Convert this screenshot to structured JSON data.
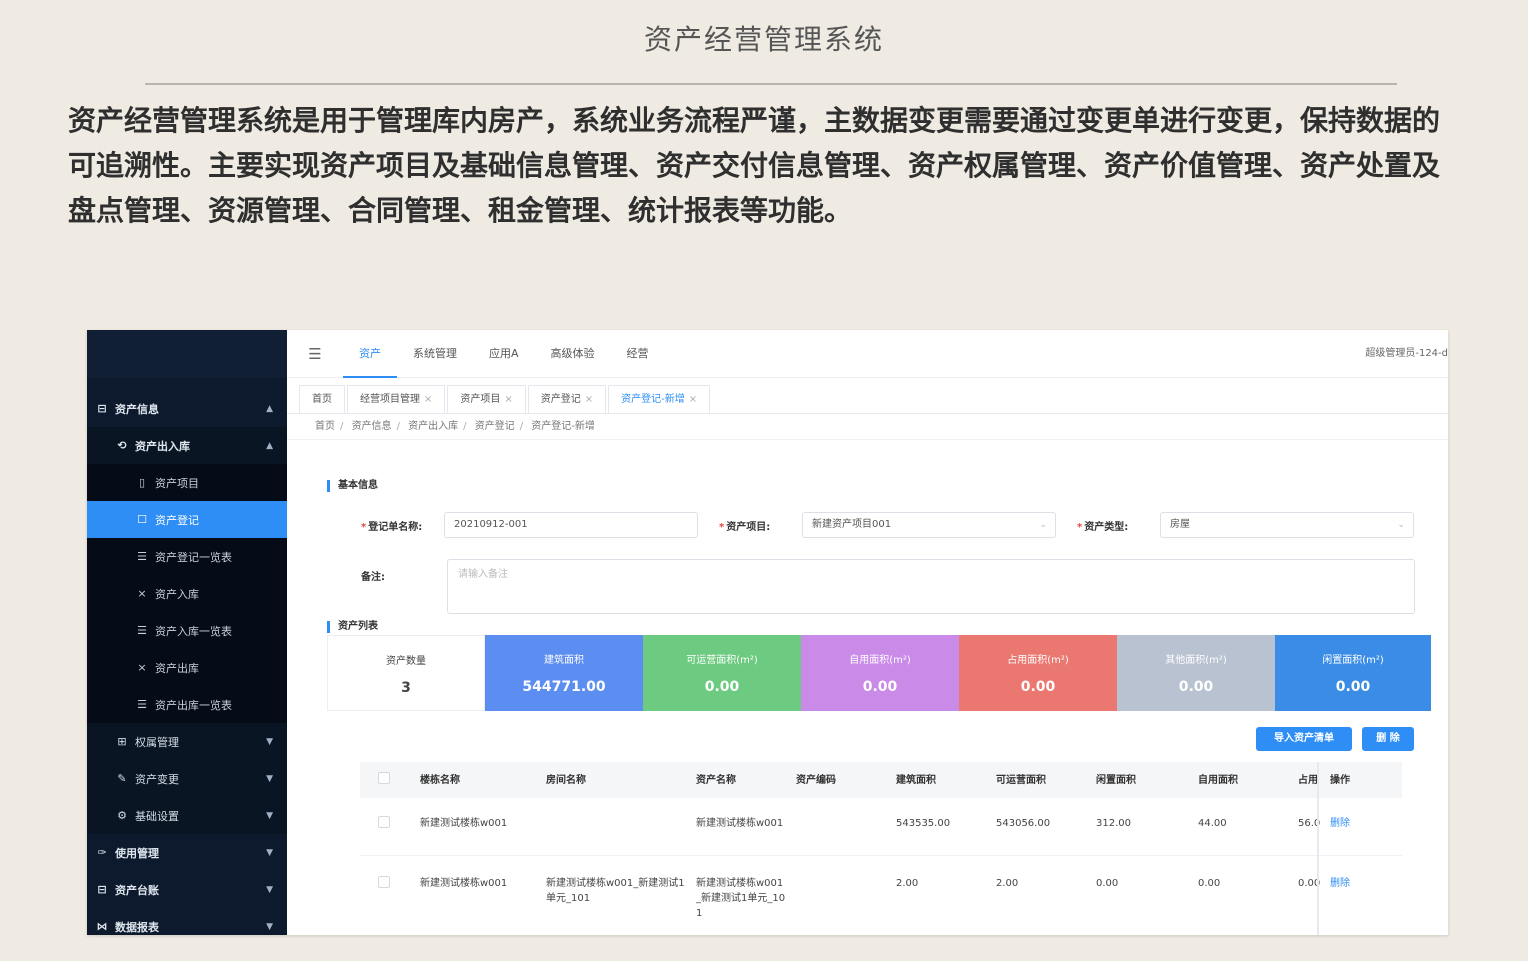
{
  "slide": {
    "title": "资产经营管理系统",
    "description": "资产经营管理系统是用于管理库内房产，系统业务流程严谨，主数据变更需要通过变更单进行变更，保持数据的可追溯性。主要实现资产项目及基础信息管理、资产交付信息管理、资产权属管理、资产价值管理、资产处置及盘点管理、资源管理、合同管理、租金管理、统计报表等功能。"
  },
  "sidebar": {
    "items": [
      {
        "label": "资产信息",
        "icon": "square-icon"
      },
      {
        "label": "资产出入库",
        "icon": "sync-icon"
      },
      {
        "label": "资产项目",
        "icon": "document-icon"
      },
      {
        "label": "资产登记",
        "icon": "form-icon"
      },
      {
        "label": "资产登记一览表",
        "icon": "list-icon"
      },
      {
        "label": "资产入库",
        "icon": "close-icon"
      },
      {
        "label": "资产入库一览表",
        "icon": "list-icon"
      },
      {
        "label": "资产出库",
        "icon": "close-icon"
      },
      {
        "label": "资产出库一览表",
        "icon": "list-icon"
      },
      {
        "label": "权属管理",
        "icon": "grid-icon"
      },
      {
        "label": "资产变更",
        "icon": "edit-icon"
      },
      {
        "label": "基础设置",
        "icon": "gear-icon"
      },
      {
        "label": "使用管理",
        "icon": "wrench-icon"
      },
      {
        "label": "资产台账",
        "icon": "square-icon"
      },
      {
        "label": "数据报表",
        "icon": "chart-icon"
      }
    ]
  },
  "topbar": {
    "tabs": [
      "资产",
      "系统管理",
      "应用A",
      "高级体验",
      "经营"
    ],
    "user": "超级管理员-124-d"
  },
  "page_tabs": [
    "首页",
    "经营项目管理",
    "资产项目",
    "资产登记",
    "资产登记-新增"
  ],
  "breadcrumb": [
    "首页",
    "资产信息",
    "资产出入库",
    "资产登记",
    "资产登记-新增"
  ],
  "form": {
    "section_basic": "基本信息",
    "reg_name_label": "登记单名称:",
    "reg_name_value": "20210912-001",
    "project_label": "资产项目:",
    "project_value": "新建资产项目001",
    "type_label": "资产类型:",
    "type_value": "房屋",
    "remark_label": "备注:",
    "remark_placeholder": "请输入备注"
  },
  "assets": {
    "section_title": "资产列表",
    "stats": [
      {
        "label": "资产数量",
        "value": "3",
        "color": "#ffffff"
      },
      {
        "label": "建筑面积",
        "value": "544771.00",
        "color": "#5b8ef0"
      },
      {
        "label": "可运营面积(m²)",
        "value": "0.00",
        "color": "#6ccb80"
      },
      {
        "label": "自用面积(m²)",
        "value": "0.00",
        "color": "#c98ae8"
      },
      {
        "label": "占用面积(m²)",
        "value": "0.00",
        "color": "#ea7770"
      },
      {
        "label": "其他面积(m²)",
        "value": "0.00",
        "color": "#b8c2d0"
      },
      {
        "label": "闲置面积(m²)",
        "value": "0.00",
        "color": "#3b8ce6"
      }
    ],
    "import_button": "导入资产清单",
    "delete_button": "删 除"
  },
  "table": {
    "headers": [
      "楼栋名称",
      "房间名称",
      "资产名称",
      "资产编码",
      "建筑面积",
      "可运营面积",
      "闲置面积",
      "自用面积",
      "占用",
      "操作"
    ],
    "rows": [
      [
        "新建测试楼栋w001",
        "",
        "新建测试楼栋w001",
        "",
        "543535.00",
        "543056.00",
        "312.00",
        "44.00",
        "56.0",
        "删除"
      ],
      [
        "新建测试楼栋w001",
        "新建测试楼栋w001_新建测试1单元_101",
        "新建测试楼栋w001_新建测试1单元_101",
        "",
        "2.00",
        "2.00",
        "0.00",
        "0.00",
        "0.00",
        "删除"
      ]
    ]
  }
}
